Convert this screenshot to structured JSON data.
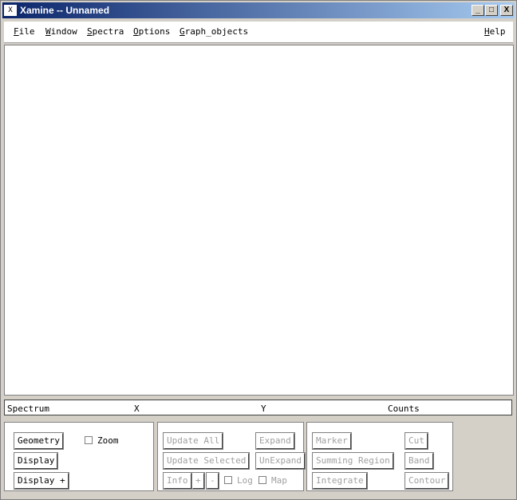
{
  "window": {
    "title": "Xamine -- Unnamed",
    "icon": "X",
    "buttons": {
      "minimize": "_",
      "maximize": "□",
      "close": "X"
    }
  },
  "menubar": {
    "file": "File",
    "window": "Window",
    "spectra": "Spectra",
    "options": "Options",
    "graph_objects": "Graph_objects",
    "help": "Help"
  },
  "status": {
    "spectrum": "Spectrum",
    "x": "X",
    "y": "Y",
    "counts": "Counts"
  },
  "panel1": {
    "geometry": "Geometry",
    "zoom": "Zoom",
    "display": "Display",
    "display_plus": "Display +"
  },
  "panel2": {
    "update_all": "Update All",
    "expand": "Expand",
    "update_selected": "Update Selected",
    "unexpand": "UnExpand",
    "info": "Info",
    "plus": "+",
    "minus": "-",
    "log": "Log",
    "map": "Map"
  },
  "panel3": {
    "marker": "Marker",
    "cut": "Cut",
    "summing_region": "Summing Region",
    "band": "Band",
    "integrate": "Integrate",
    "contour": "Contour"
  },
  "colors": {
    "titlebar_start": "#0a246a",
    "titlebar_end": "#a6caf0",
    "disabled_text": "#a0a0a0"
  }
}
